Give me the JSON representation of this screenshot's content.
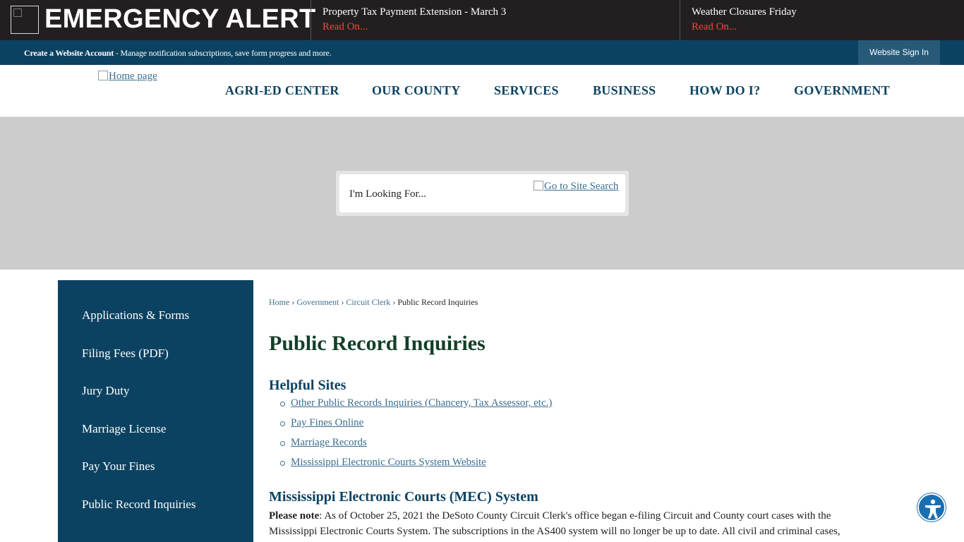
{
  "alert": {
    "title": "EMERGENCY ALERT",
    "items": [
      {
        "title": "Property Tax Payment Extension - March 3",
        "read": "Read On..."
      },
      {
        "title": "Weather Closures Friday",
        "read": "Read On..."
      }
    ]
  },
  "account": {
    "create_label": "Create a Website Account",
    "description": " - Manage notification subscriptions, save form progress and more.",
    "signin_label": "Website Sign In"
  },
  "header": {
    "home_alt": "Home page",
    "nav": [
      "AGRI-ED CENTER",
      "OUR COUNTY",
      "SERVICES",
      "BUSINESS",
      "HOW DO I?",
      "GOVERNMENT"
    ]
  },
  "search": {
    "placeholder": "I'm Looking For...",
    "go_alt": "Go to Site Search"
  },
  "sidebar": {
    "items": [
      "Applications & Forms",
      "Filing Fees (PDF)",
      "Jury Duty",
      "Marriage License",
      "Pay Your Fines",
      "Public Record Inquiries"
    ]
  },
  "breadcrumb": {
    "items": [
      "Home",
      "Government",
      "Circuit Clerk"
    ],
    "current": "Public Record Inquiries",
    "separator": "›"
  },
  "main": {
    "title": "Public Record Inquiries",
    "helpful_heading": "Helpful Sites",
    "links": [
      "Other Public Records Inquiries (Chancery, Tax Assessor, etc.)",
      "Pay Fines Online",
      "Marriage Records ",
      "Mississippi Electronic Courts System Website"
    ],
    "mec_heading": "Mississippi Electronic Courts (MEC) System",
    "note_label": "Please note",
    "note_text": ": As of October 25, 2021 the DeSoto County Circuit Clerk's office began e-filing Circuit and County court cases with the Mississippi Electronic Courts System. The subscriptions in the AS400 system will no longer be up to date.   All civil and criminal cases,"
  },
  "icons": {
    "alert": "broken-image-icon",
    "accessibility": "accessibility-icon"
  },
  "colors": {
    "alert_bg": "#231f20",
    "read_on": "#f0493b",
    "brand_navy": "#0c4261",
    "title_green": "#133f27",
    "link": "#3b6d8f",
    "banner_gray": "#cccccc",
    "a11y_blue": "#1a6fb0"
  }
}
